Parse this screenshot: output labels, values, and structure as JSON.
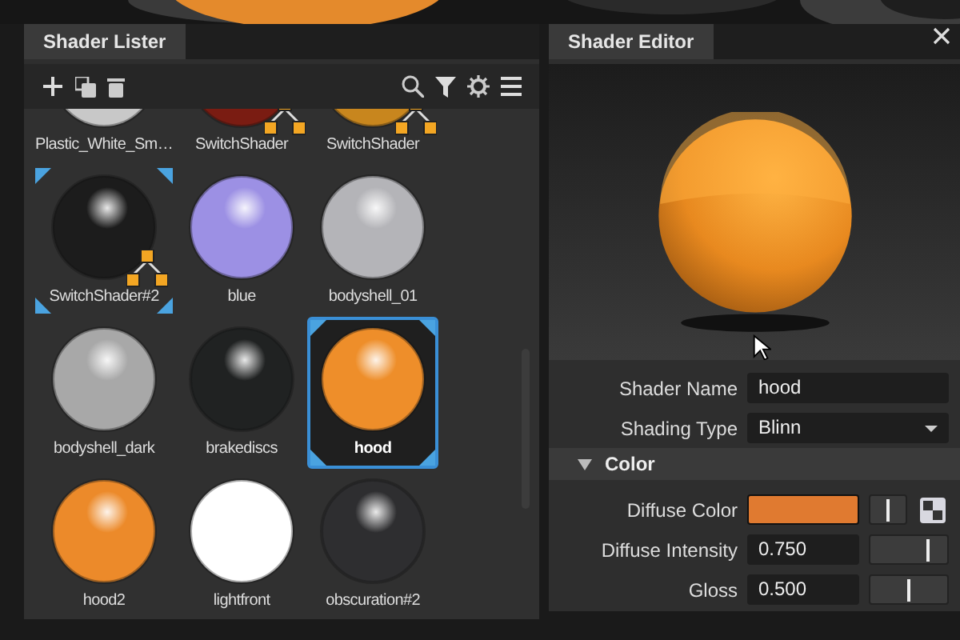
{
  "lister": {
    "title": "Shader Lister",
    "items": [
      {
        "label": "Plastic_White_Sm…",
        "color": "#c8c8c8",
        "switch": false,
        "tagged": false,
        "selected": false
      },
      {
        "label": "SwitchShader",
        "color": "#7a1c12",
        "switch": true,
        "tagged": false,
        "selected": false
      },
      {
        "label": "SwitchShader",
        "color": "#c8861e",
        "switch": true,
        "tagged": false,
        "selected": false
      },
      {
        "label": "SwitchShader#2",
        "color": "#1c1c1c",
        "switch": true,
        "tagged": true,
        "selected": false
      },
      {
        "label": "blue",
        "color": "#9c90e4",
        "switch": false,
        "tagged": false,
        "selected": false
      },
      {
        "label": "bodyshell_01",
        "color": "#b4b4b8",
        "switch": false,
        "tagged": false,
        "selected": false
      },
      {
        "label": "bodyshell_dark",
        "color": "#a8a8a8",
        "switch": false,
        "tagged": false,
        "selected": false
      },
      {
        "label": "brakediscs",
        "color": "#202222",
        "switch": false,
        "tagged": false,
        "selected": false
      },
      {
        "label": "hood",
        "color": "#ee8e2a",
        "switch": false,
        "tagged": true,
        "selected": true
      },
      {
        "label": "hood2",
        "color": "#ec8a2a",
        "switch": false,
        "tagged": false,
        "selected": false
      },
      {
        "label": "lightfront",
        "color": "#ffffff",
        "switch": false,
        "tagged": false,
        "selected": false
      },
      {
        "label": "obscuration#2",
        "color": "#2e2e30",
        "switch": false,
        "tagged": false,
        "selected": false
      }
    ]
  },
  "editor": {
    "title": "Shader Editor",
    "fields": [
      {
        "kind": "text",
        "label": "Shader Name",
        "value": "hood"
      },
      {
        "kind": "dropdown",
        "label": "Shading Type",
        "value": "Blinn"
      },
      {
        "kind": "section",
        "label": "Color",
        "expanded": true
      },
      {
        "kind": "color",
        "label": "Diffuse Color",
        "color": "#e07a30",
        "level": 0.5
      },
      {
        "kind": "number",
        "label": "Diffuse Intensity",
        "value": "0.750",
        "level": 0.75
      },
      {
        "kind": "number",
        "label": "Gloss",
        "value": "0.500",
        "level": 0.5
      }
    ]
  }
}
